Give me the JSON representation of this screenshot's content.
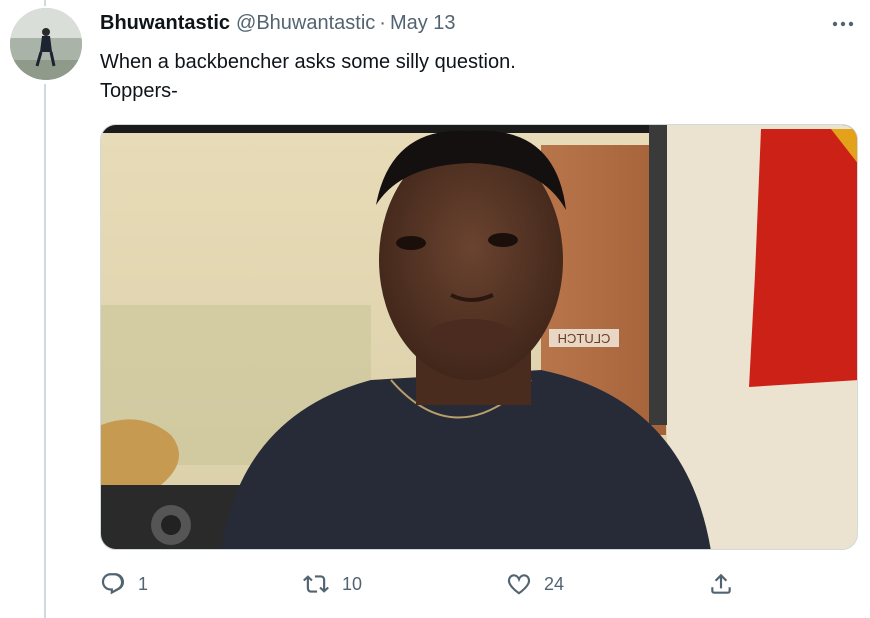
{
  "tweet": {
    "author_name": "Bhuwantastic",
    "author_handle": "@Bhuwantastic",
    "separator": "·",
    "date": "May 13",
    "text_lines": [
      "When a backbencher asks some silly question.",
      "Toppers-"
    ],
    "media_sign_text": "CLUTCH"
  },
  "actions": {
    "reply_count": "1",
    "retweet_count": "10",
    "like_count": "24"
  },
  "icons": {
    "more": "more-icon",
    "reply": "reply-icon",
    "retweet": "retweet-icon",
    "like": "like-icon",
    "share": "share-icon"
  },
  "colors": {
    "text_primary": "#0f1419",
    "text_secondary": "#536471",
    "thread_line": "#cfd9de"
  }
}
